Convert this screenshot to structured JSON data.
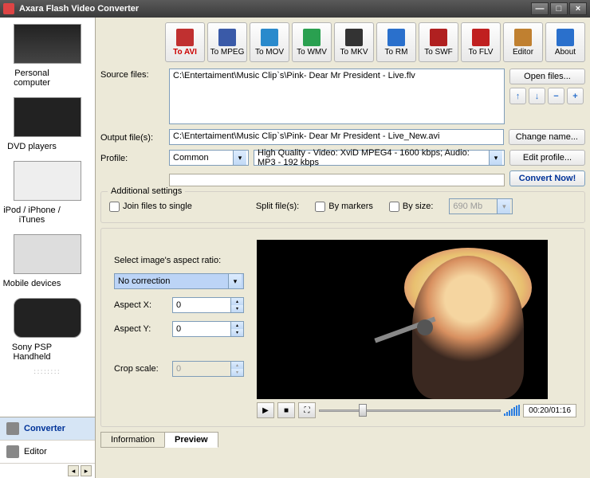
{
  "window": {
    "title": "Axara Flash Video Converter"
  },
  "sidebar": {
    "devices": [
      {
        "label": "Personal computer"
      },
      {
        "label": "DVD players"
      },
      {
        "label": "iPod / iPhone / iTunes"
      },
      {
        "label": "Mobile devices"
      },
      {
        "label": "Sony PSP Handheld"
      }
    ],
    "tabs": [
      {
        "label": "Converter"
      },
      {
        "label": "Editor"
      }
    ]
  },
  "toolbar": {
    "buttons": [
      {
        "label": "To AVI",
        "color": "#c03030"
      },
      {
        "label": "To MPEG",
        "color": "#3a5aa8"
      },
      {
        "label": "To MOV",
        "color": "#2a8acc"
      },
      {
        "label": "To WMV",
        "color": "#2aa050"
      },
      {
        "label": "To MKV",
        "color": "#333"
      },
      {
        "label": "To RM",
        "color": "#2a70cc"
      },
      {
        "label": "To SWF",
        "color": "#b02020"
      },
      {
        "label": "To FLV",
        "color": "#c02020"
      },
      {
        "label": "Editor",
        "color": "#c08030"
      },
      {
        "label": "About",
        "color": "#2a70cc"
      }
    ]
  },
  "labels": {
    "source": "Source files:",
    "output": "Output file(s):",
    "profile": "Profile:",
    "additional": "Additional settings",
    "join": "Join files to single",
    "split": "Split file(s):",
    "bymarkers": "By markers",
    "bysize": "By size:",
    "aspect": "Select image's aspect ratio:",
    "aspectx": "Aspect X:",
    "aspecty": "Aspect Y:",
    "crop": "Crop scale:"
  },
  "buttons": {
    "open": "Open files...",
    "change": "Change name...",
    "editprofile": "Edit profile...",
    "convert": "Convert Now!"
  },
  "values": {
    "source": "C:\\Entertaiment\\Music Clip`s\\Pink- Dear Mr President - Live.flv",
    "output": "C:\\Entertaiment\\Music Clip`s\\Pink- Dear Mr President - Live_New.avi",
    "profile_cat": "Common",
    "profile_full": "High Quality - Video: XviD MPEG4 - 1600 kbps; Audio: MP3 - 192 kbps",
    "size": "690 Mb",
    "aspect_sel": "No correction",
    "aspectx": "0",
    "aspecty": "0",
    "crop": "0",
    "time": "00:20/01:16"
  },
  "tabs": {
    "info": "Information",
    "preview": "Preview"
  }
}
